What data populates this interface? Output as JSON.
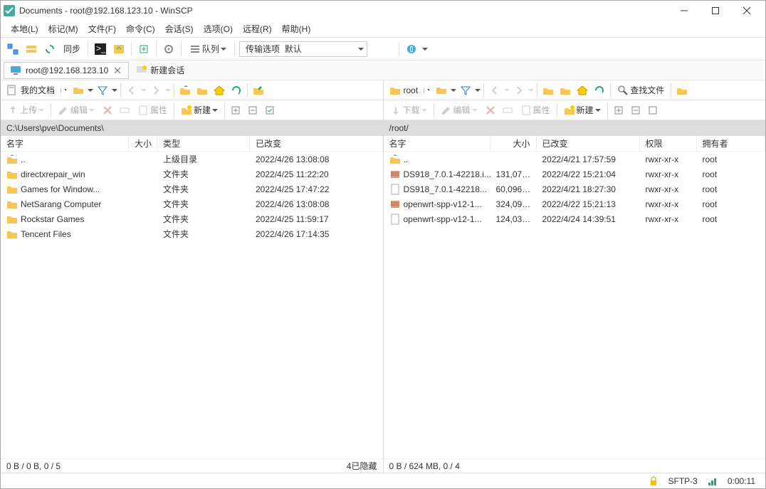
{
  "window": {
    "title": "Documents - root@192.168.123.10 - WinSCP"
  },
  "menu": {
    "local": "本地(L)",
    "mark": "标记(M)",
    "files": "文件(F)",
    "commands": "命令(C)",
    "session": "会话(S)",
    "options": "选项(O)",
    "remote": "远程(R)",
    "help": "帮助(H)"
  },
  "toolbar": {
    "sync": "同步",
    "queue": "队列",
    "transfer_opts": "传输选项",
    "defaults": "默认"
  },
  "tabs": {
    "session": "root@192.168.123.10",
    "new_session": "新建会话"
  },
  "left": {
    "drive": "我的文档",
    "upload": "上传",
    "edit": "编辑",
    "properties": "属性",
    "new": "新建",
    "path": "C:\\Users\\pve\\Documents\\",
    "cols": {
      "name": "名字",
      "size": "大小",
      "type": "类型",
      "changed": "已改变"
    },
    "rows": [
      {
        "name": "..",
        "type": "上级目录",
        "changed": "2022/4/26  13:08:08",
        "icon": "up"
      },
      {
        "name": "directxrepair_win",
        "type": "文件夹",
        "changed": "2022/4/25  11:22:20",
        "icon": "folder"
      },
      {
        "name": "Games for Window...",
        "type": "文件夹",
        "changed": "2022/4/25  17:47:22",
        "icon": "folder"
      },
      {
        "name": "NetSarang Computer",
        "type": "文件夹",
        "changed": "2022/4/26  13:08:08",
        "icon": "folder"
      },
      {
        "name": "Rockstar Games",
        "type": "文件夹",
        "changed": "2022/4/25  11:59:17",
        "icon": "folder"
      },
      {
        "name": "Tencent Files",
        "type": "文件夹",
        "changed": "2022/4/26  17:14:35",
        "icon": "folder"
      }
    ],
    "status_left": "0 B / 0 B,   0 / 5",
    "status_right": "4已隐藏"
  },
  "right": {
    "drive": "root",
    "download": "下载",
    "edit": "编辑",
    "properties": "属性",
    "new": "新建",
    "find": "查找文件",
    "path": "/root/",
    "cols": {
      "name": "名字",
      "size": "大小",
      "changed": "已改变",
      "perms": "权限",
      "owner": "拥有者"
    },
    "rows": [
      {
        "name": "..",
        "size": "",
        "changed": "2022/4/21 17:57:59",
        "perms": "rwxr-xr-x",
        "owner": "root",
        "icon": "up"
      },
      {
        "name": "DS918_7.0.1-42218.i...",
        "size": "131,072...",
        "changed": "2022/4/22 15:21:04",
        "perms": "rwxr-xr-x",
        "owner": "root",
        "icon": "archive"
      },
      {
        "name": "DS918_7.0.1-42218...",
        "size": "60,096 ...",
        "changed": "2022/4/21 18:27:30",
        "perms": "rwxr-xr-x",
        "owner": "root",
        "icon": "file"
      },
      {
        "name": "openwrt-spp-v12-1...",
        "size": "324,096...",
        "changed": "2022/4/22 15:21:13",
        "perms": "rwxr-xr-x",
        "owner": "root",
        "icon": "archive"
      },
      {
        "name": "openwrt-spp-v12-1...",
        "size": "124,032...",
        "changed": "2022/4/24 14:39:51",
        "perms": "rwxr-xr-x",
        "owner": "root",
        "icon": "file"
      }
    ],
    "status": "0 B / 624 MB,   0 / 4"
  },
  "footer": {
    "protocol": "SFTP-3",
    "time": "0:00:11"
  }
}
